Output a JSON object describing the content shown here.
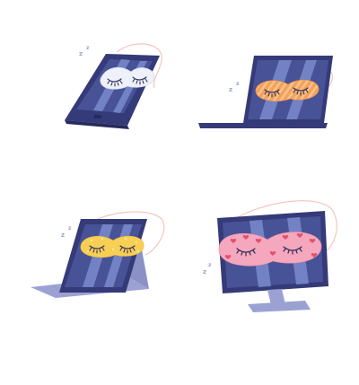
{
  "scene": {
    "illustrations": [
      {
        "id": "phone",
        "device": "smartphone",
        "sleep_mask": "white",
        "sleep_symbol": "z z"
      },
      {
        "id": "laptop",
        "device": "laptop",
        "sleep_mask": "orange-striped",
        "sleep_symbol": "z z"
      },
      {
        "id": "tablet",
        "device": "tablet-on-stand",
        "sleep_mask": "yellow-dotted",
        "sleep_symbol": "z z"
      },
      {
        "id": "monitor",
        "device": "desktop-monitor",
        "sleep_mask": "pink-hearts",
        "sleep_symbol": "z z"
      }
    ]
  },
  "colors": {
    "device_frame": "#353a78",
    "screen_dark": "#485296",
    "screen_light": "#7d8fd0",
    "stand": "#9ba2d3",
    "mask_white": "#eef1f9",
    "mask_orange": "#f4a25a",
    "mask_yellow": "#f7cf55",
    "mask_pink": "#f5a7bd",
    "heart_red": "#e2506e",
    "strap": "#f3c5c0",
    "eyelash": "#2f2f5a"
  }
}
